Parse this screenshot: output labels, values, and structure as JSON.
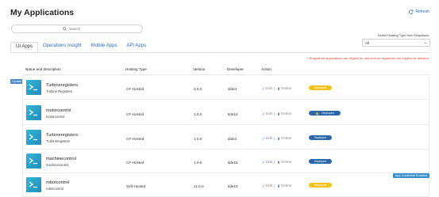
{
  "header": {
    "title": "My Applications",
    "refresh_label": "Refresh"
  },
  "search": {
    "placeholder": "Search"
  },
  "tabs": [
    {
      "label": "UI Apps",
      "active": true
    },
    {
      "label": "Operations Insight",
      "active": false
    },
    {
      "label": "Mobile Apps",
      "active": false
    },
    {
      "label": "API Apps",
      "active": false
    }
  ],
  "filter": {
    "label": "Select Hosting Type from Dropdown:",
    "selected": "All"
  },
  "notice": "* Registered applications are eligible for edit and not registered are eligible for deletion.",
  "table": {
    "columns": {
      "name": "Name and description",
      "hosting": "Hosting Type",
      "version": "Version",
      "developer": "Developer",
      "action": "Action"
    },
    "edit_label": "Edit",
    "delete_label": "Delete",
    "separator": "|",
    "rows": [
      {
        "name": "Turbineregisters",
        "description": "Turbine Registers",
        "hosting": "CF-Hosted",
        "version": "2.0.0",
        "developer": "dide4",
        "status": "Deployed",
        "status_color": "#f3c11c",
        "warning": false
      },
      {
        "name": "motorcontrol",
        "description": "motorcontrol",
        "hosting": "CF-Hosted",
        "version": "1.0.0",
        "developer": "tide18",
        "status": "Deployed",
        "status_color": "#2a66a8",
        "warning": true
      },
      {
        "name": "Turbineregisters",
        "description": "Turbineregisters",
        "hosting": "CF-Hosted",
        "version": "1.0.0",
        "developer": "dide4",
        "status": "Deployed",
        "status_color": "#2a66a8",
        "warning": false
      },
      {
        "name": "machinecontrol",
        "description": "machinecontrol",
        "hosting": "CF-Hosted",
        "version": "1.0.0",
        "developer": "tide18",
        "status": "Deployed",
        "status_color": "#2a66a8",
        "warning": false
      },
      {
        "name": "robotcontrol",
        "description": "robotcontrol",
        "hosting": "Self-Hosted",
        "version": "v1.0.0",
        "developer": "tide19",
        "status": "Deployed",
        "status_color": "#f3c11c",
        "warning": false
      }
    ]
  },
  "tags": {
    "update": "Update",
    "credential": "App Credential Enabled"
  },
  "icons": {
    "refresh": "refresh-icon",
    "search": "search-icon",
    "app": "terminal-app-icon",
    "edit": "pencil-icon",
    "delete": "trash-icon",
    "warning": "warning-icon"
  }
}
